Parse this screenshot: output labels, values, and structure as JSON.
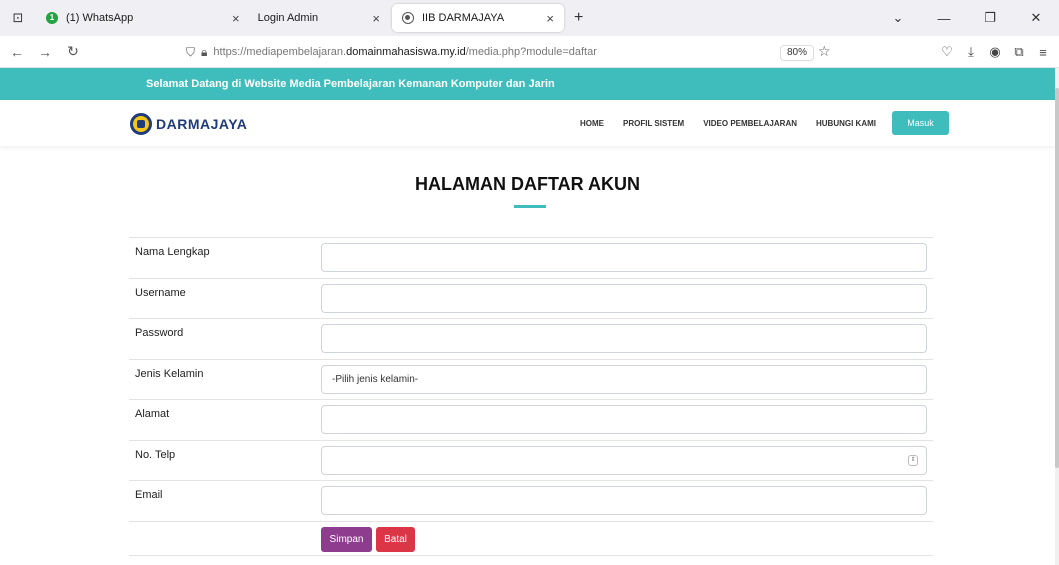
{
  "browser": {
    "tabs": [
      {
        "label": "(1) WhatsApp",
        "badge": "1"
      },
      {
        "label": "Login Admin"
      },
      {
        "label": "IIB DARMAJAYA"
      }
    ],
    "new_tab": "+",
    "url_base": "https://mediapembelajaran.",
    "url_domain": "domainmahasiswa.my.id",
    "url_path": "/media.php?module=daftar",
    "zoom": "80%"
  },
  "site": {
    "banner": "Selamat Datang di Website Media Pembelajaran Kemanan Komputer dan Jarin",
    "logo_name": "DARMAJAYA",
    "nav": [
      "HOME",
      "PROFIL SISTEM",
      "VIDEO PEMBELAJARAN",
      "HUBUNGI KAMI"
    ],
    "login_button": "Masuk"
  },
  "form": {
    "title": "HALAMAN DAFTAR AKUN",
    "fields": [
      {
        "label": "Nama Lengkap",
        "value": ""
      },
      {
        "label": "Username",
        "value": ""
      },
      {
        "label": "Password",
        "value": ""
      },
      {
        "label": "Jenis Kelamin",
        "value": "-Pilih jenis kelamin-"
      },
      {
        "label": "Alamat",
        "value": ""
      },
      {
        "label": "No. Telp",
        "value": ""
      },
      {
        "label": "Email",
        "value": ""
      }
    ],
    "submit_label": "Simpan",
    "cancel_label": "Batal"
  },
  "colors": {
    "accent": "#3fbcbc",
    "submit": "#8e3d8e",
    "cancel": "#dc3545"
  }
}
